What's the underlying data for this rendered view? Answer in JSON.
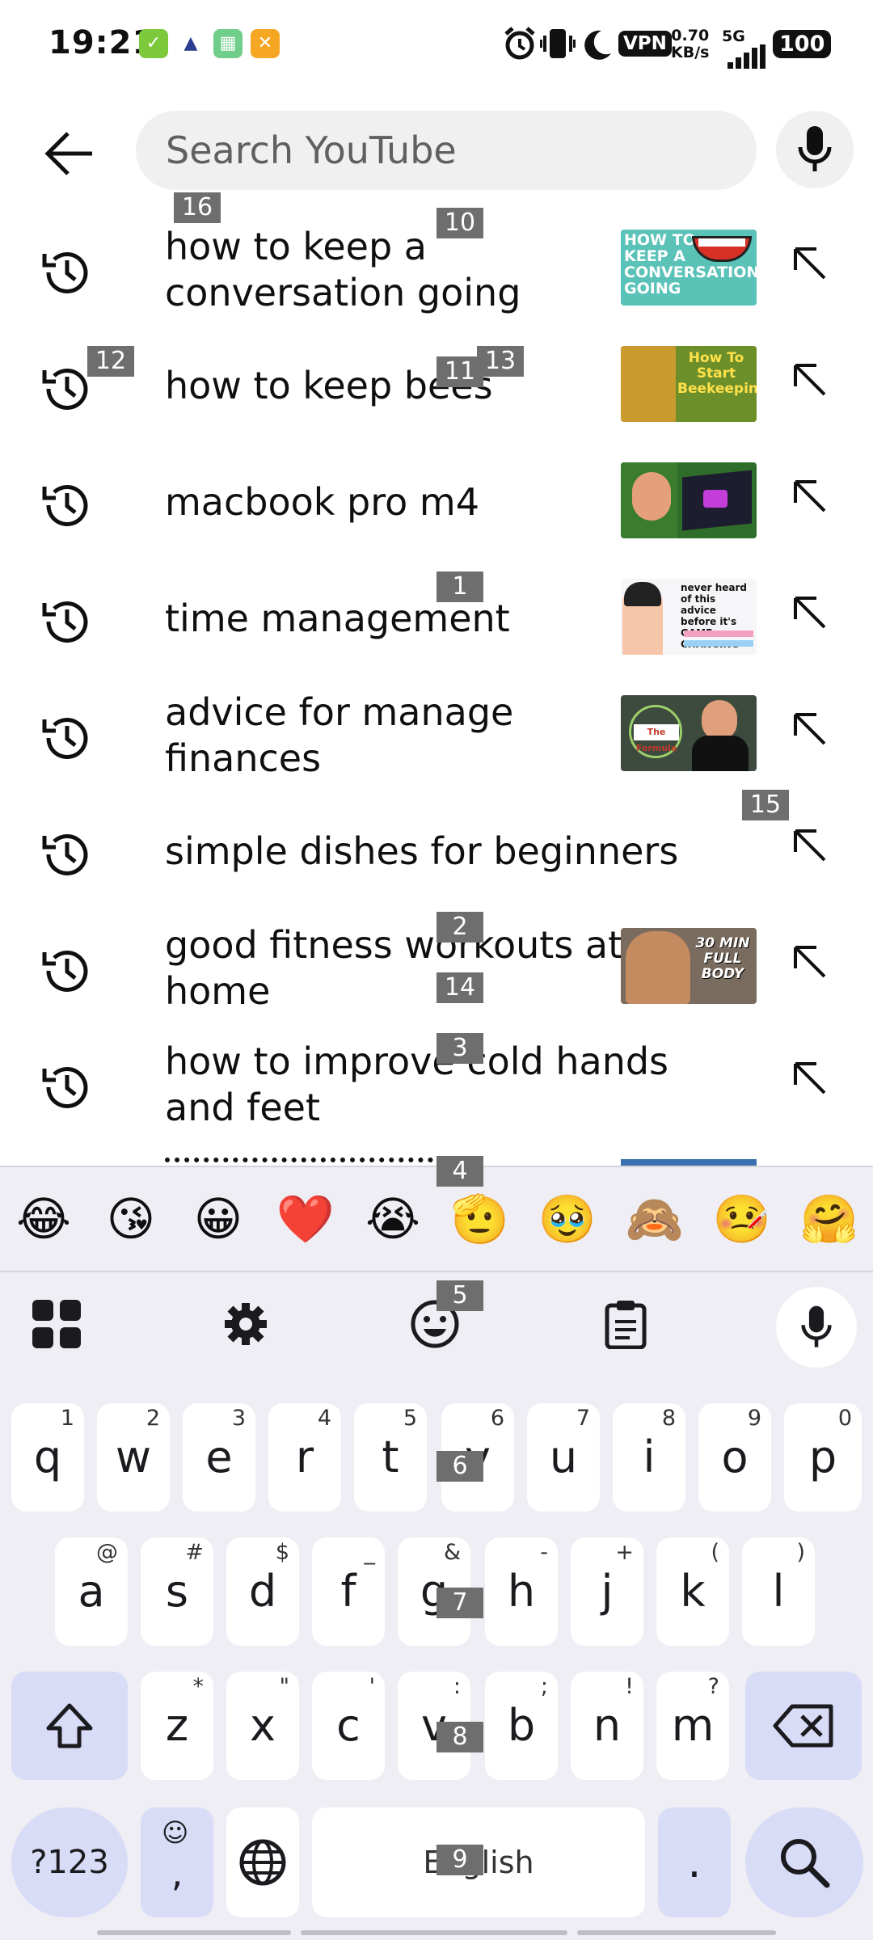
{
  "status_bar": {
    "time": "19:21",
    "vpn": "VPN",
    "speed_value": "0.70",
    "speed_unit": "KB/s",
    "network": "5G",
    "battery": "100"
  },
  "search": {
    "placeholder": "Search YouTube"
  },
  "suggestions": [
    {
      "text": "how to keep a conversation going",
      "thumb_text": "HOW TO KEEP A CONVERSATION GOING"
    },
    {
      "text": "how to keep bees",
      "thumb_text": "How To Start Beekeeping"
    },
    {
      "text": "macbook pro m4",
      "thumb_text": ""
    },
    {
      "text": "time management",
      "thumb_text": "never heard of this advice before it's GAME-CHANGING"
    },
    {
      "text": "advice for manage finances",
      "thumb_text": "The Formula"
    },
    {
      "text": "simple dishes for beginners",
      "thumb_text": ""
    },
    {
      "text": "good fitness workouts at home",
      "thumb_text": "30 MIN FULL BODY"
    },
    {
      "text": "how to improve cold hands and feet",
      "thumb_text": ""
    }
  ],
  "markers": [
    "16",
    "10",
    "12",
    "11",
    "13",
    "1",
    "15",
    "2",
    "14",
    "3",
    "4",
    "5",
    "6",
    "7",
    "8",
    "9"
  ],
  "keyboard": {
    "emojis": [
      "😂",
      "😘",
      "😀",
      "❤️",
      "😭",
      "🫡",
      "🥹",
      "🙈",
      "🤒",
      "🤗"
    ],
    "row1": [
      {
        "k": "q",
        "h": "1"
      },
      {
        "k": "w",
        "h": "2"
      },
      {
        "k": "e",
        "h": "3"
      },
      {
        "k": "r",
        "h": "4"
      },
      {
        "k": "t",
        "h": "5"
      },
      {
        "k": "y",
        "h": "6"
      },
      {
        "k": "u",
        "h": "7"
      },
      {
        "k": "i",
        "h": "8"
      },
      {
        "k": "o",
        "h": "9"
      },
      {
        "k": "p",
        "h": "0"
      }
    ],
    "row2": [
      {
        "k": "a",
        "h": "@"
      },
      {
        "k": "s",
        "h": "#"
      },
      {
        "k": "d",
        "h": "$"
      },
      {
        "k": "f",
        "h": "_"
      },
      {
        "k": "g",
        "h": "&"
      },
      {
        "k": "h",
        "h": "-"
      },
      {
        "k": "j",
        "h": "+"
      },
      {
        "k": "k",
        "h": "("
      },
      {
        "k": "l",
        "h": ")"
      }
    ],
    "row3": [
      {
        "k": "z",
        "h": "*"
      },
      {
        "k": "x",
        "h": "\""
      },
      {
        "k": "c",
        "h": "'"
      },
      {
        "k": "v",
        "h": ":"
      },
      {
        "k": "b",
        "h": ";"
      },
      {
        "k": "n",
        "h": "!"
      },
      {
        "k": "m",
        "h": "?"
      }
    ],
    "sym_label": "?123",
    "comma": ",",
    "space_label": "English",
    "period": "."
  }
}
